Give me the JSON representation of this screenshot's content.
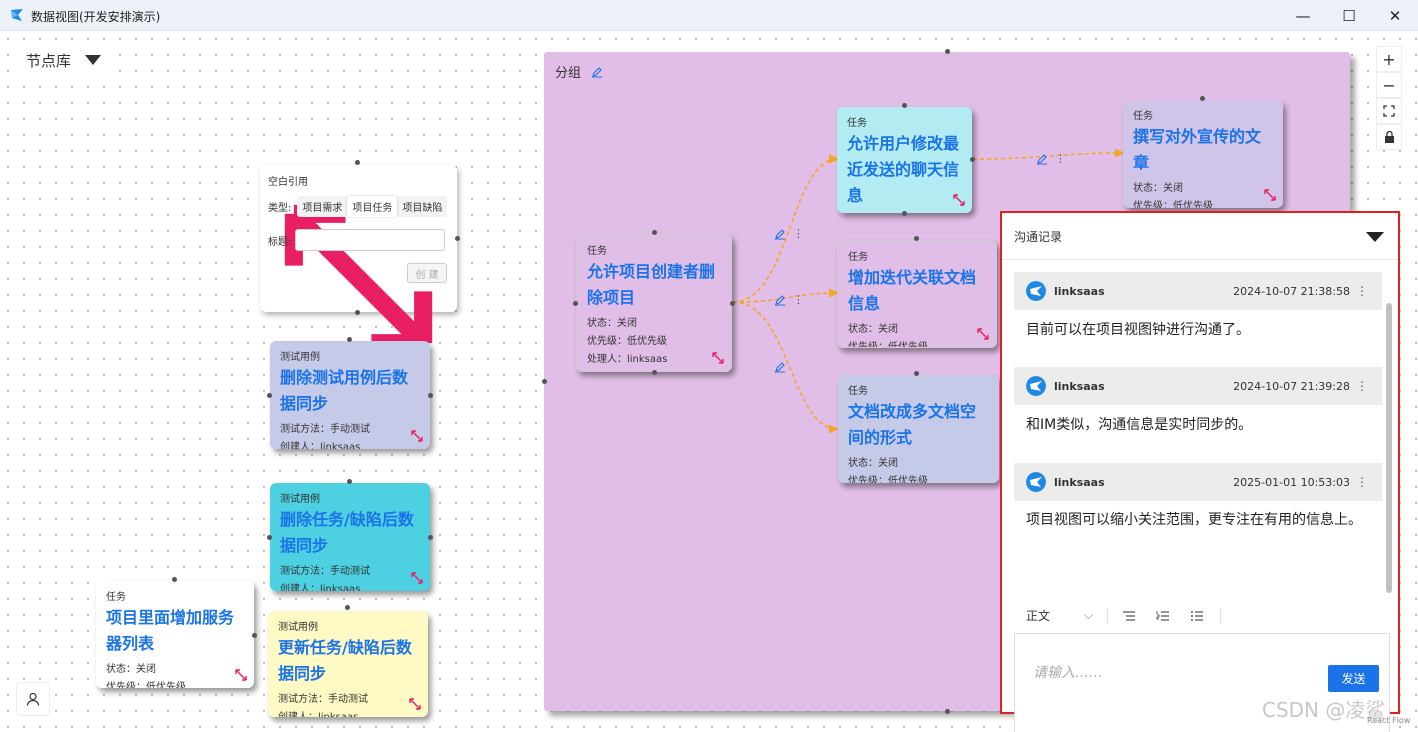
{
  "window": {
    "title": "数据视图(开发安排演示)",
    "minimize": "—",
    "maximize": "☐",
    "close": "✕"
  },
  "toolbar": {
    "node_library": "节点库"
  },
  "zoom_controls": {
    "zoom_in": "+",
    "zoom_out": "−"
  },
  "group": {
    "label": "分组"
  },
  "ref_card": {
    "title": "空白引用",
    "type_label": "类型:",
    "types": [
      "项目需求",
      "项目任务",
      "项目缺陷"
    ],
    "selected_type": "项目任务",
    "title_label": "标题:",
    "title_value": "",
    "create_label": "创 建"
  },
  "cards": [
    {
      "type": "测试用例",
      "title": "删除测试用例后数据同步",
      "lines": [
        "测试方法：手动测试",
        "创建人：linksaas"
      ]
    },
    {
      "type": "测试用例",
      "title": "删除任务/缺陷后数据同步",
      "lines": [
        "测试方法：手动测试",
        "创建人：linksaas"
      ]
    },
    {
      "type": "任务",
      "title": "项目里面增加服务器列表",
      "lines": [
        "状态：关闭",
        "优先级：低优先级"
      ]
    },
    {
      "type": "测试用例",
      "title": "更新任务/缺陷后数据同步",
      "lines": [
        "测试方法：手动测试",
        "创建人：linksaas"
      ]
    },
    {
      "type": "任务",
      "title": "允许项目创建者删除项目",
      "lines": [
        "状态：关闭",
        "优先级：低优先级",
        "处理人：linksaas"
      ]
    },
    {
      "type": "任务",
      "title": "允许用户修改最近发送的聊天信息",
      "lines": []
    },
    {
      "type": "任务",
      "title": "增加迭代关联文档信息",
      "lines": [
        "状态：关闭",
        "优先级：低优先级"
      ]
    },
    {
      "type": "任务",
      "title": "文档改成多文档空间的形式",
      "lines": [
        "状态：关闭",
        "优先级：低优先级"
      ]
    },
    {
      "type": "任务",
      "title": "撰写对外宣传的文章",
      "lines": [
        "状态：关闭",
        "优先级：低优先级"
      ]
    }
  ],
  "chat": {
    "title": "沟通记录",
    "messages": [
      {
        "user": "linksaas",
        "time": "2024-10-07 21:38:58",
        "text": "目前可以在项目视图钟进行沟通了。"
      },
      {
        "user": "linksaas",
        "time": "2024-10-07 21:39:28",
        "text": "和IM类似，沟通信息是实时同步的。"
      },
      {
        "user": "linksaas",
        "time": "2025-01-01 10:53:03",
        "text": "项目视图可以缩小关注范围，更专注在有用的信息上。"
      }
    ],
    "format_label": "正文",
    "placeholder": "请输入……",
    "send_label": "发送"
  },
  "watermark": "CSDN @凌鲨",
  "react_flow": "React Flow",
  "colors": {
    "accent": "#1a73e8",
    "group_bg": "#e1bee7",
    "edge": "#f5a623",
    "panel_border": "#e02020"
  }
}
